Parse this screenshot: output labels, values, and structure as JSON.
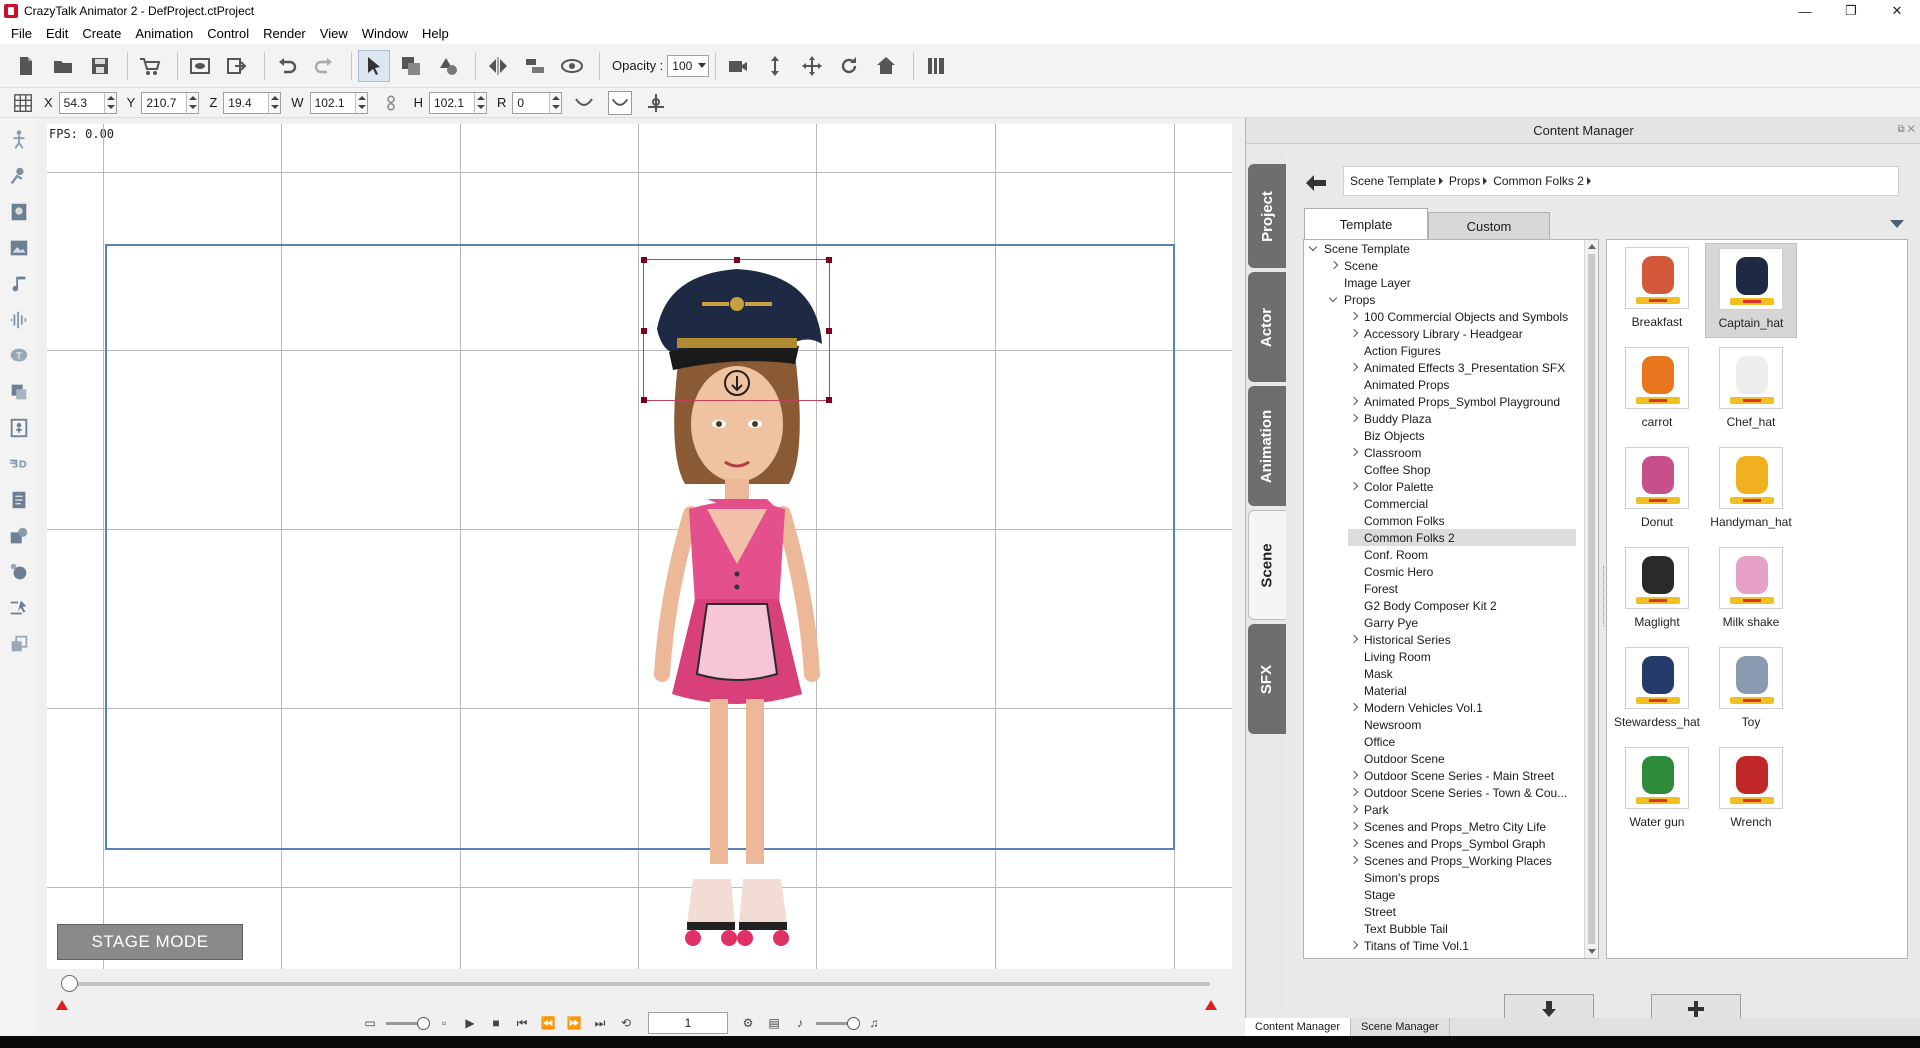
{
  "window": {
    "title": "CrazyTalk Animator 2  - DefProject.ctProject",
    "controls": [
      "—",
      "❐",
      "✕"
    ]
  },
  "menu": [
    "File",
    "Edit",
    "Create",
    "Animation",
    "Control",
    "Render",
    "View",
    "Window",
    "Help"
  ],
  "toolbar": {
    "opacity_label": "Opacity :",
    "opacity_value": "100"
  },
  "transform": {
    "x_label": "X",
    "x_value": "54.3",
    "y_label": "Y",
    "y_value": "210.7",
    "z_label": "Z",
    "z_value": "19.4",
    "w_label": "W",
    "w_value": "102.1",
    "h_label": "H",
    "h_value": "102.1",
    "r_label": "R",
    "r_value": "0"
  },
  "viewport": {
    "fps": "FPS: 0.00",
    "stage_mode": "STAGE MODE"
  },
  "playback": {
    "frame": "1"
  },
  "content_manager": {
    "title": "Content Manager",
    "side_tabs": [
      "Project",
      "Actor",
      "Animation",
      "Scene",
      "SFX"
    ],
    "active_side_tab": "Scene",
    "breadcrumb": [
      "Scene Template",
      "Props",
      "Common Folks 2"
    ],
    "tabs": {
      "template": "Template",
      "custom": "Custom"
    },
    "tree": [
      {
        "label": "Scene Template",
        "level": 0,
        "exp": "open"
      },
      {
        "label": "Scene",
        "level": 1,
        "exp": "closed"
      },
      {
        "label": "Image Layer",
        "level": 1,
        "exp": ""
      },
      {
        "label": "Props",
        "level": 1,
        "exp": "open"
      },
      {
        "label": "100 Commercial Objects and Symbols",
        "level": 2,
        "exp": "closed"
      },
      {
        "label": "Accessory Library - Headgear",
        "level": 2,
        "exp": "closed"
      },
      {
        "label": "Action Figures",
        "level": 2,
        "exp": ""
      },
      {
        "label": "Animated Effects 3_Presentation SFX",
        "level": 2,
        "exp": "closed"
      },
      {
        "label": "Animated Props",
        "level": 2,
        "exp": ""
      },
      {
        "label": "Animated Props_Symbol Playground",
        "level": 2,
        "exp": "closed"
      },
      {
        "label": "Buddy Plaza",
        "level": 2,
        "exp": "closed"
      },
      {
        "label": "Biz Objects",
        "level": 2,
        "exp": ""
      },
      {
        "label": "Classroom",
        "level": 2,
        "exp": "closed"
      },
      {
        "label": "Coffee Shop",
        "level": 2,
        "exp": ""
      },
      {
        "label": "Color Palette",
        "level": 2,
        "exp": "closed"
      },
      {
        "label": "Commercial",
        "level": 2,
        "exp": ""
      },
      {
        "label": "Common Folks",
        "level": 2,
        "exp": ""
      },
      {
        "label": "Common Folks 2",
        "level": 2,
        "exp": "",
        "selected": true
      },
      {
        "label": "Conf. Room",
        "level": 2,
        "exp": ""
      },
      {
        "label": "Cosmic Hero",
        "level": 2,
        "exp": ""
      },
      {
        "label": "Forest",
        "level": 2,
        "exp": ""
      },
      {
        "label": "G2 Body Composer Kit 2",
        "level": 2,
        "exp": ""
      },
      {
        "label": "Garry Pye",
        "level": 2,
        "exp": ""
      },
      {
        "label": "Historical Series",
        "level": 2,
        "exp": "closed"
      },
      {
        "label": "Living Room",
        "level": 2,
        "exp": ""
      },
      {
        "label": "Mask",
        "level": 2,
        "exp": ""
      },
      {
        "label": "Material",
        "level": 2,
        "exp": ""
      },
      {
        "label": "Modern Vehicles Vol.1",
        "level": 2,
        "exp": "closed"
      },
      {
        "label": "Newsroom",
        "level": 2,
        "exp": ""
      },
      {
        "label": "Office",
        "level": 2,
        "exp": ""
      },
      {
        "label": "Outdoor Scene",
        "level": 2,
        "exp": ""
      },
      {
        "label": "Outdoor Scene Series - Main Street",
        "level": 2,
        "exp": "closed"
      },
      {
        "label": "Outdoor Scene Series - Town & Cou...",
        "level": 2,
        "exp": "closed"
      },
      {
        "label": "Park",
        "level": 2,
        "exp": "closed"
      },
      {
        "label": "Scenes and Props_Metro City Life",
        "level": 2,
        "exp": "closed"
      },
      {
        "label": "Scenes and Props_Symbol Graph",
        "level": 2,
        "exp": "closed"
      },
      {
        "label": "Scenes and Props_Working Places",
        "level": 2,
        "exp": "closed"
      },
      {
        "label": "Simon's props",
        "level": 2,
        "exp": ""
      },
      {
        "label": "Stage",
        "level": 2,
        "exp": ""
      },
      {
        "label": "Street",
        "level": 2,
        "exp": ""
      },
      {
        "label": "Text Bubble Tail",
        "level": 2,
        "exp": ""
      },
      {
        "label": "Titans of Time Vol.1",
        "level": 2,
        "exp": "closed"
      }
    ],
    "items": [
      {
        "label": "Breakfast",
        "color": "#d4593a"
      },
      {
        "label": "Captain_hat",
        "color": "#1e2a44",
        "selected": true
      },
      {
        "label": "carrot",
        "color": "#e8761e"
      },
      {
        "label": "Chef_hat",
        "color": "#eeeeee"
      },
      {
        "label": "Donut",
        "color": "#c8508a"
      },
      {
        "label": "Handyman_hat",
        "color": "#f0b020"
      },
      {
        "label": "Maglight",
        "color": "#2a2a2a"
      },
      {
        "label": "Milk shake",
        "color": "#e7a0c8"
      },
      {
        "label": "Stewardess_hat",
        "color": "#253b6a"
      },
      {
        "label": "Toy",
        "color": "#8a9ab0"
      },
      {
        "label": "Water gun",
        "color": "#2e8b3a"
      },
      {
        "label": "Wrench",
        "color": "#c02828"
      }
    ]
  },
  "bottom_tabs": [
    "Content Manager",
    "Scene Manager"
  ]
}
